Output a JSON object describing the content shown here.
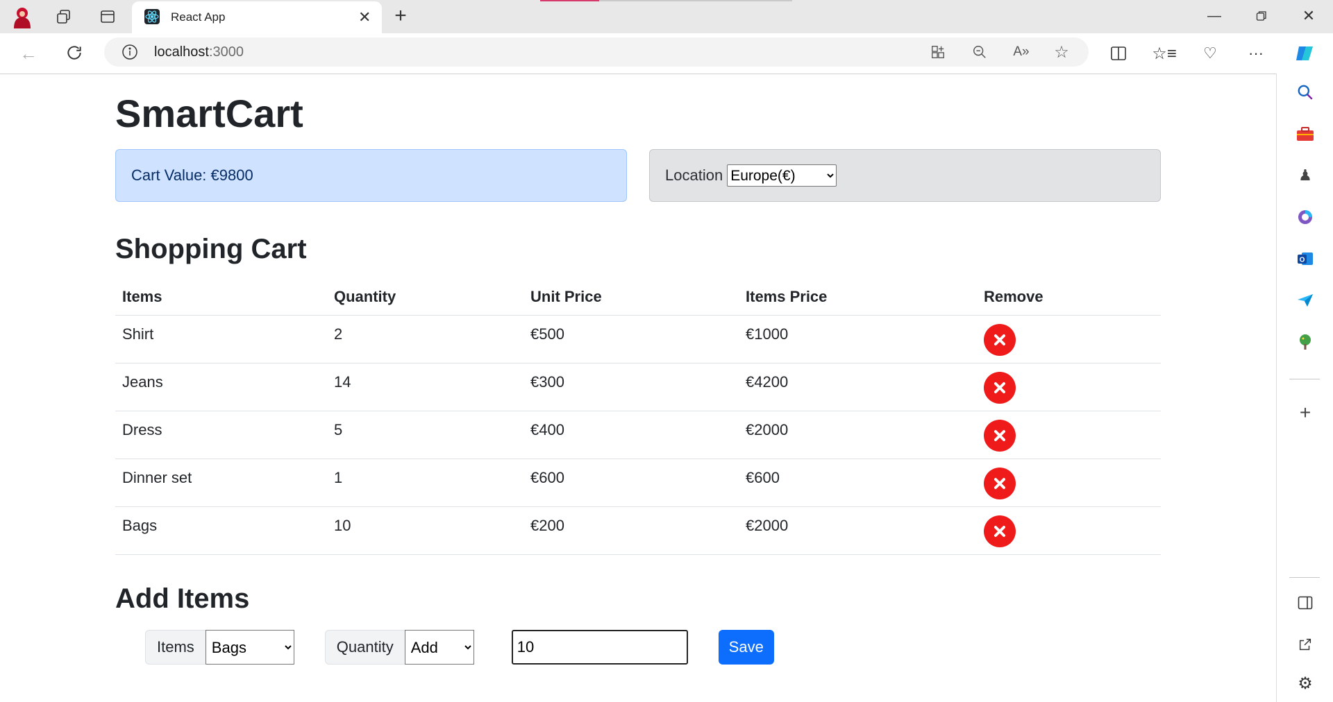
{
  "browser": {
    "tab_title": "React App",
    "url_host": "localhost",
    "url_port": ":3000"
  },
  "app": {
    "title": "SmartCart",
    "cart_value_label": "Cart Value: €9800",
    "location_label": "Location",
    "location_selected": "Europe(€)"
  },
  "cart": {
    "heading": "Shopping Cart",
    "columns": [
      "Items",
      "Quantity",
      "Unit Price",
      "Items Price",
      "Remove"
    ],
    "rows": [
      {
        "item": "Shirt",
        "quantity": "2",
        "unit_price": "€500",
        "items_price": "€1000"
      },
      {
        "item": "Jeans",
        "quantity": "14",
        "unit_price": "€300",
        "items_price": "€4200"
      },
      {
        "item": "Dress",
        "quantity": "5",
        "unit_price": "€400",
        "items_price": "€2000"
      },
      {
        "item": "Dinner set",
        "quantity": "1",
        "unit_price": "€600",
        "items_price": "€600"
      },
      {
        "item": "Bags",
        "quantity": "10",
        "unit_price": "€200",
        "items_price": "€2000"
      }
    ]
  },
  "add_items": {
    "heading": "Add Items",
    "items_label": "Items",
    "items_selected": "Bags",
    "quantity_label": "Quantity",
    "action_selected": "Add",
    "quantity_value": "10",
    "save_label": "Save"
  },
  "colors": {
    "primary": "#0d6efd",
    "remove": "#ef1b1b",
    "alert_primary_bg": "#cfe2ff",
    "alert_secondary_bg": "#e2e3e5"
  }
}
